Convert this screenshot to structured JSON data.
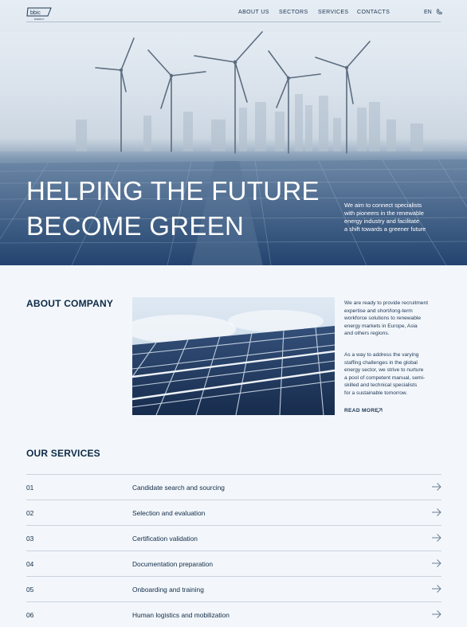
{
  "nav": {
    "logo_text": "bbic",
    "logo_subtext": "ENERGY",
    "links": [
      "ABOUT US",
      "SECTORS",
      "SERVICES",
      "CONTACTS"
    ],
    "lang": "EN",
    "phone_icon": "phone-icon"
  },
  "hero": {
    "title_line1": "HELPING THE FUTURE",
    "title_line2": "BECOME GREEN",
    "subtitle_lines": [
      "We aim to connect specialists",
      "with pioneers in the renewable",
      "energy industry and facilitate",
      "a shift towards a greener future"
    ]
  },
  "about": {
    "title": "ABOUT COMPANY",
    "para1": [
      "We are ready to provide recruitment",
      "expertise and short/long-term",
      "workforce solutions to renewable",
      "energy markets in Europe, Asia",
      "and others regions."
    ],
    "para2": [
      "As a way to address the varying",
      "staffing challenges in the global",
      "energy sector, we strive to nurture",
      "a pool of competent manual, semi-",
      "skilled and technical specialists",
      "for a sustainable tomorrow."
    ],
    "read_more": "READ MORE",
    "read_more_icon": "arrow-up-right-icon"
  },
  "services": {
    "title": "OUR SERVICES",
    "items": [
      {
        "num": "01",
        "label": "Candidate search and sourcing"
      },
      {
        "num": "02",
        "label": "Selection and evaluation"
      },
      {
        "num": "03",
        "label": "Certification validation"
      },
      {
        "num": "04",
        "label": "Documentation preparation"
      },
      {
        "num": "05",
        "label": "Onboarding and training"
      },
      {
        "num": "06",
        "label": "Human logistics and mobilization"
      }
    ],
    "arrow_icon": "arrow-right-icon"
  },
  "colors": {
    "page_bg": "#f3f7fb",
    "text": "#0f2a47",
    "divider": "#c9d3de",
    "hero_dark": "#2b4d78"
  }
}
